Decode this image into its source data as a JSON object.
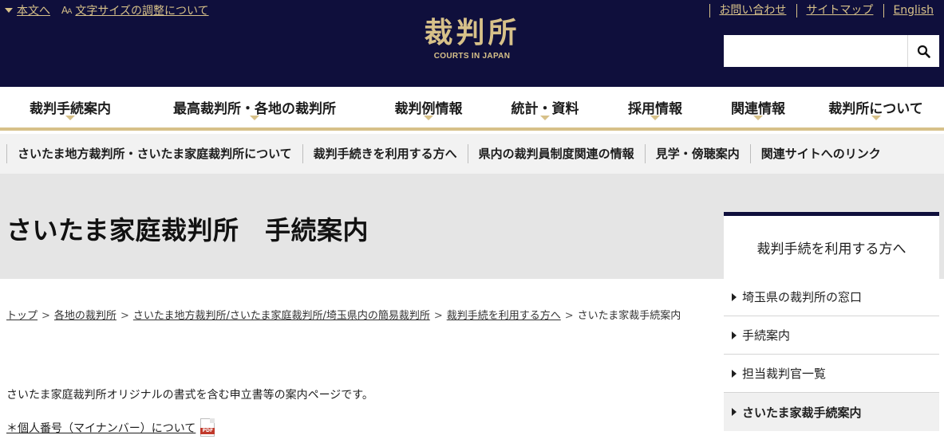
{
  "header": {
    "skip_link": "本文へ",
    "font_size_link": "文字サイズの調整について",
    "util_links": [
      "お問い合わせ",
      "サイトマップ",
      "English"
    ],
    "logo_kanji": "裁判所",
    "logo_english": "COURTS IN JAPAN",
    "search": {
      "value": "",
      "placeholder": ""
    },
    "colors": {
      "background": "#0f0f3c",
      "accent": "#d7c189"
    }
  },
  "global_nav": [
    "裁判手続案内",
    "最高裁判所・各地の裁判所",
    "裁判例情報",
    "統計・資料",
    "採用情報",
    "関連情報",
    "裁判所について"
  ],
  "local_nav": [
    "さいたま地方裁判所・さいたま家庭裁判所について",
    "裁判手続きを利用する方へ",
    "県内の裁判員制度関連の情報",
    "見学・傍聴案内",
    "関連サイトへのリンク"
  ],
  "page_title": "さいたま家庭裁判所　手続案内",
  "breadcrumb": {
    "links": [
      "トップ",
      "各地の裁判所",
      "さいたま地方裁判所/さいたま家庭裁判所/埼玉県内の簡易裁判所",
      "裁判手続を利用する方へ"
    ],
    "current": "さいたま家裁手続案内",
    "separator": ">"
  },
  "content": {
    "intro": "さいたま家庭裁判所オリジナルの書式を含む申立書等の案内ページです。",
    "mynumber_link": "＊個人番号（マイナンバー）について",
    "pdf_label": "PDF"
  },
  "side_nav": {
    "heading": "裁判手続を利用する方へ",
    "items": [
      "埼玉県の裁判所の窓口",
      "手続案内",
      "担当裁判官一覧",
      "さいたま家裁手続案内"
    ],
    "active_item": "さいたま家裁手続案内"
  }
}
